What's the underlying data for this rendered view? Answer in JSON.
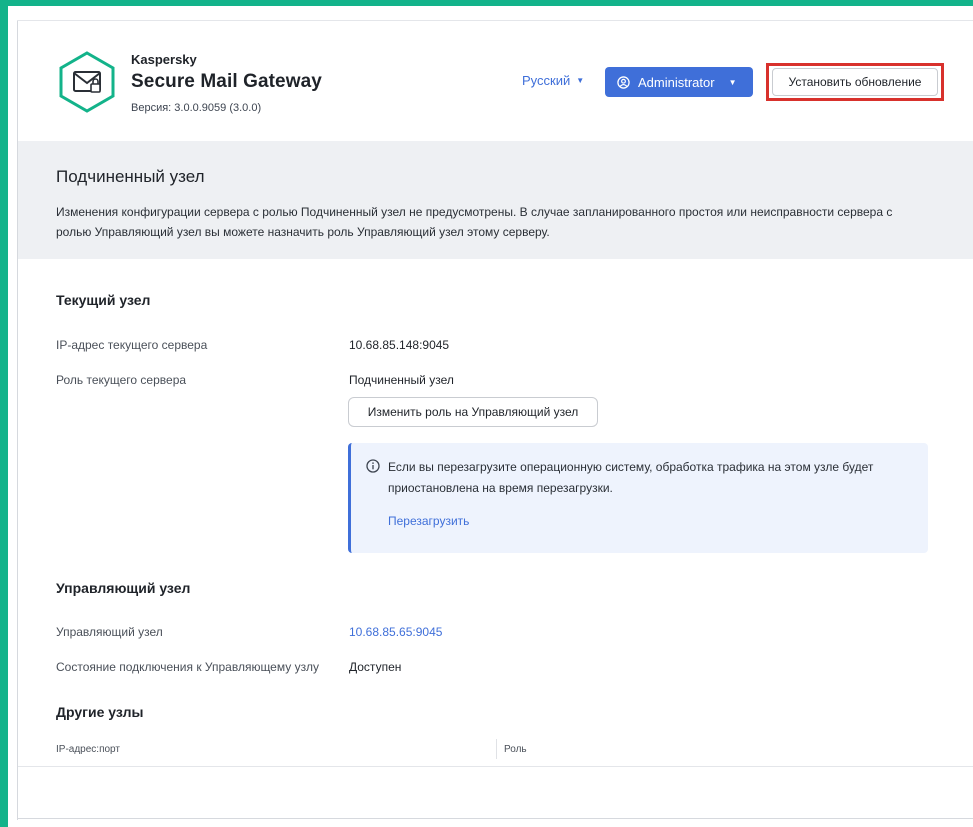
{
  "header": {
    "vendor": "Kaspersky",
    "product": "Secure Mail Gateway",
    "version": "Версия: 3.0.0.9059 (3.0.0)",
    "language": "Русский",
    "user": "Administrator",
    "install_update": "Установить обновление"
  },
  "banner": {
    "title": "Подчиненный узел",
    "text": "Изменения конфигурации сервера с ролью Подчиненный узел не предусмотрены. В случае запланированного простоя или неисправности сервера с ролью Управляющий узел вы можете назначить роль Управляющий узел этому серверу."
  },
  "current_node": {
    "title": "Текущий узел",
    "ip_label": "IP-адрес текущего сервера",
    "ip_value": "10.68.85.148:9045",
    "role_label": "Роль текущего сервера",
    "role_value": "Подчиненный узел",
    "change_role_button": "Изменить роль на Управляющий узел"
  },
  "notice": {
    "text": "Если вы перезагрузите операционную систему, обработка трафика на этом узле будет приостановлена на время перезагрузки.",
    "action": "Перезагрузить"
  },
  "managing_node": {
    "title": "Управляющий узел",
    "node_label": "Управляющий узел",
    "node_value": "10.68.85.65:9045",
    "status_label": "Состояние подключения к Управляющему узлу",
    "status_value": "Доступен"
  },
  "other_nodes": {
    "title": "Другие узлы",
    "columns": [
      "IP-адрес:порт",
      "Роль"
    ]
  },
  "colors": {
    "frame": "#13b38a",
    "accent": "#3f6fd9",
    "highlight": "#d8312c",
    "banner_bg": "#eef0f3"
  },
  "icons": {
    "logo": "mail-lock-icon",
    "user": "user-circle-icon",
    "notice": "info-icon"
  }
}
